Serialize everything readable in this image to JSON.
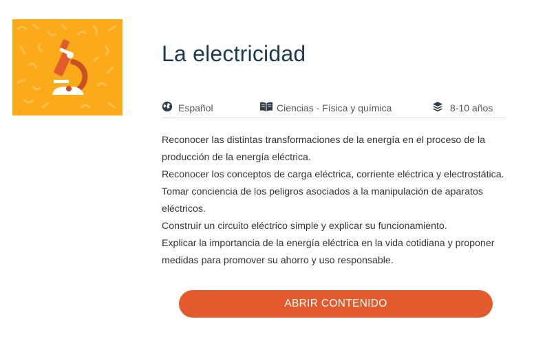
{
  "lesson": {
    "title": "La electricidad",
    "thumbnail_icon": "microscope-icon",
    "thumbnail_color": "#fbab19"
  },
  "meta": {
    "language": {
      "icon": "globe-icon",
      "label": "Español"
    },
    "subject": {
      "icon": "book-icon",
      "label": "Ciencias - Física y química"
    },
    "age": {
      "icon": "layers-icon",
      "label": "8-10 años"
    }
  },
  "objectives": [
    "Reconocer las distintas transformaciones de la energía en el proceso de la producción de la energía eléctrica.",
    "Reconocer los conceptos de carga eléctrica, corriente eléctrica y electrostática.",
    "Tomar conciencia de los peligros asociados a la manipulación de aparatos eléctricos.",
    "Construir un circuito eléctrico simple y explicar su funcionamiento.",
    "Explicar la importancia de la energía eléctrica en la vida cotidiana y proponer medidas para promover su ahorro y uso responsable."
  ],
  "actions": {
    "open_label": "ABRIR CONTENIDO",
    "accent_color": "#e35b2c"
  }
}
